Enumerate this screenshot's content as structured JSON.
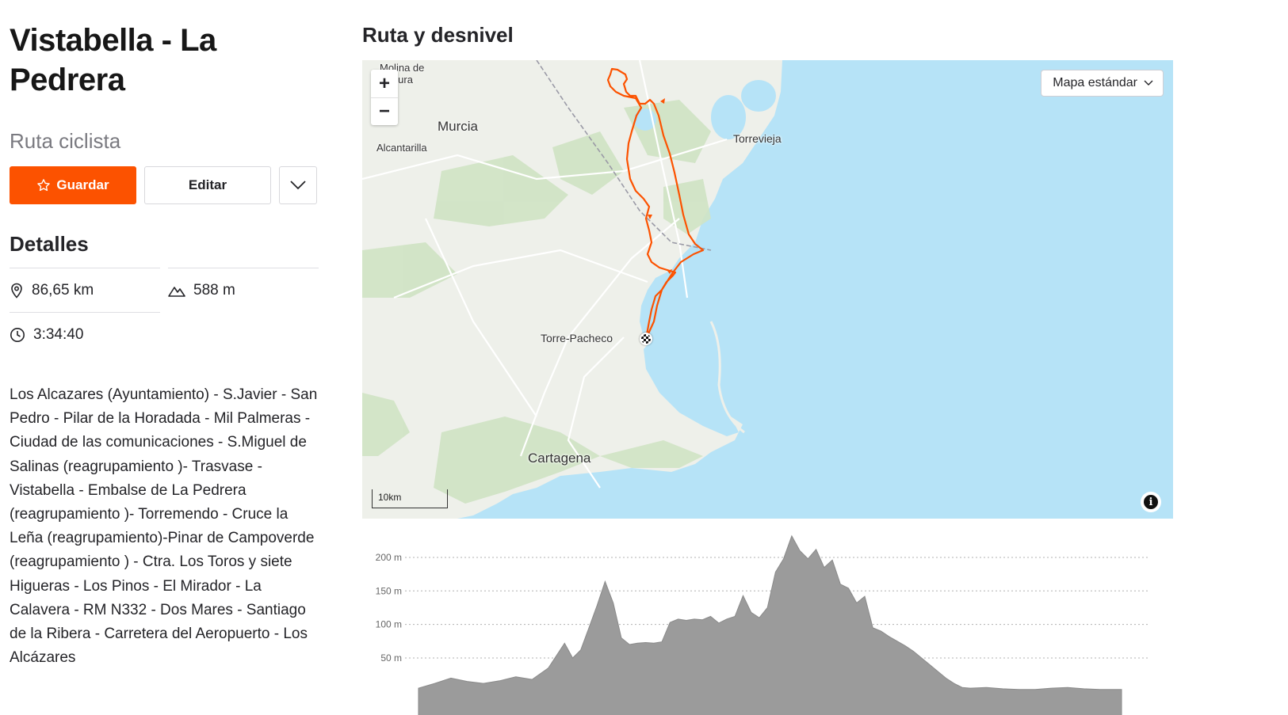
{
  "route": {
    "title": "Vistabella - La Pedrera",
    "type": "Ruta ciclista",
    "description": "Los Alcazares (Ayuntamiento) - S.Javier - San Pedro - Pilar de la Horadada - Mil Palmeras - Ciudad de las comunicaciones - S.Miguel de Salinas (reagrupamiento )- Trasvase - Vistabella - Embalse de La Pedrera (reagrupamiento )- Torremendo - Cruce la Leña (reagrupamiento)-Pinar de Campoverde (reagrupamiento ) - Ctra. Los Toros y siete Higueras - Los Pinos - El Mirador - La Calavera - RM N332 - Dos Mares - Santiago de la Ribera - Carretera del Aeropuerto - Los Alcázares"
  },
  "actions": {
    "save_label": "Guardar",
    "edit_label": "Editar",
    "more_icon": "chevron-down-icon"
  },
  "details": {
    "heading": "Detalles",
    "distance": "86,65 km",
    "elevation_gain": "588 m",
    "time": "3:34:40"
  },
  "map": {
    "heading": "Ruta y desnivel",
    "zoom_in": "+",
    "zoom_out": "−",
    "map_type": "Mapa estándar",
    "scale": "10km",
    "info": "i",
    "labels": {
      "molina": "Molina de Segura",
      "murcia": "Murcia",
      "alcantarilla": "Alcantarilla",
      "torrevieja": "Torrevieja",
      "torrepacheco": "Torre-Pacheco",
      "cartagena": "Cartagena"
    },
    "colors": {
      "route": "#fc5200",
      "sea": "#b6e3f7",
      "land": "#eef0ea",
      "accent": "#fc5200"
    }
  },
  "chart_data": {
    "type": "area",
    "yticks": [
      {
        "value": 50,
        "label": "50 m"
      },
      {
        "value": 100,
        "label": "100 m"
      },
      {
        "value": 150,
        "label": "150 m"
      },
      {
        "value": 200,
        "label": "200 m"
      }
    ],
    "ylim": [
      0,
      240
    ],
    "xlim": [
      0,
      86.65
    ],
    "grid": true,
    "x": [
      0,
      2,
      4,
      6,
      8,
      10,
      12,
      14,
      16,
      18,
      19,
      20,
      21,
      22,
      23,
      24,
      25,
      26,
      27,
      28,
      29,
      30,
      31,
      32,
      33,
      34,
      35,
      36,
      37,
      38,
      39,
      40,
      41,
      42,
      43,
      44,
      45,
      46,
      47,
      48,
      49,
      50,
      51,
      52,
      53,
      54,
      55,
      56,
      57,
      58,
      59,
      60,
      61,
      62,
      63,
      64,
      65,
      66,
      67,
      68,
      70,
      72,
      74,
      76,
      78,
      80,
      82,
      84,
      86.65
    ],
    "values": [
      5,
      12,
      20,
      15,
      12,
      16,
      22,
      18,
      35,
      72,
      50,
      62,
      95,
      128,
      164,
      132,
      80,
      70,
      72,
      73,
      72,
      74,
      103,
      108,
      106,
      108,
      107,
      112,
      102,
      108,
      112,
      143,
      118,
      110,
      125,
      178,
      198,
      232,
      210,
      198,
      212,
      185,
      196,
      160,
      154,
      132,
      142,
      95,
      90,
      82,
      75,
      68,
      60,
      50,
      40,
      30,
      20,
      12,
      6,
      5,
      6,
      4,
      3,
      3,
      5,
      6,
      4,
      3,
      3
    ]
  }
}
